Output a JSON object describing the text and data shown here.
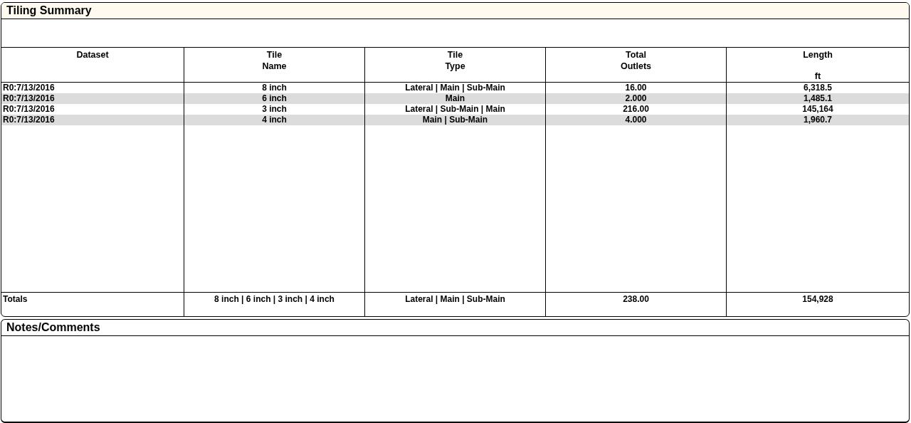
{
  "summary": {
    "title": "Tiling Summary",
    "columns": [
      {
        "lines": [
          "Dataset"
        ]
      },
      {
        "lines": [
          "Tile",
          "Name"
        ]
      },
      {
        "lines": [
          "Tile",
          "Type"
        ]
      },
      {
        "lines": [
          "Total",
          "Outlets"
        ]
      },
      {
        "lines": [
          "Length"
        ],
        "unit": "ft"
      }
    ],
    "rows": [
      [
        "R0:7/13/2016",
        "8 inch",
        "Lateral | Main | Sub-Main",
        "16.00",
        "6,318.5"
      ],
      [
        "R0:7/13/2016",
        "6 inch",
        "Main",
        "2.000",
        "1,485.1"
      ],
      [
        "R0:7/13/2016",
        "3 inch",
        "Lateral | Sub-Main | Main",
        "216.00",
        "145,164"
      ],
      [
        "R0:7/13/2016",
        "4 inch",
        "Main | Sub-Main",
        "4.000",
        "1,960.7"
      ]
    ],
    "totals": [
      "Totals",
      "8 inch | 6 inch | 3 inch | 4 inch",
      "Lateral | Main | Sub-Main",
      "238.00",
      "154,928"
    ]
  },
  "notes": {
    "title": "Notes/Comments"
  }
}
